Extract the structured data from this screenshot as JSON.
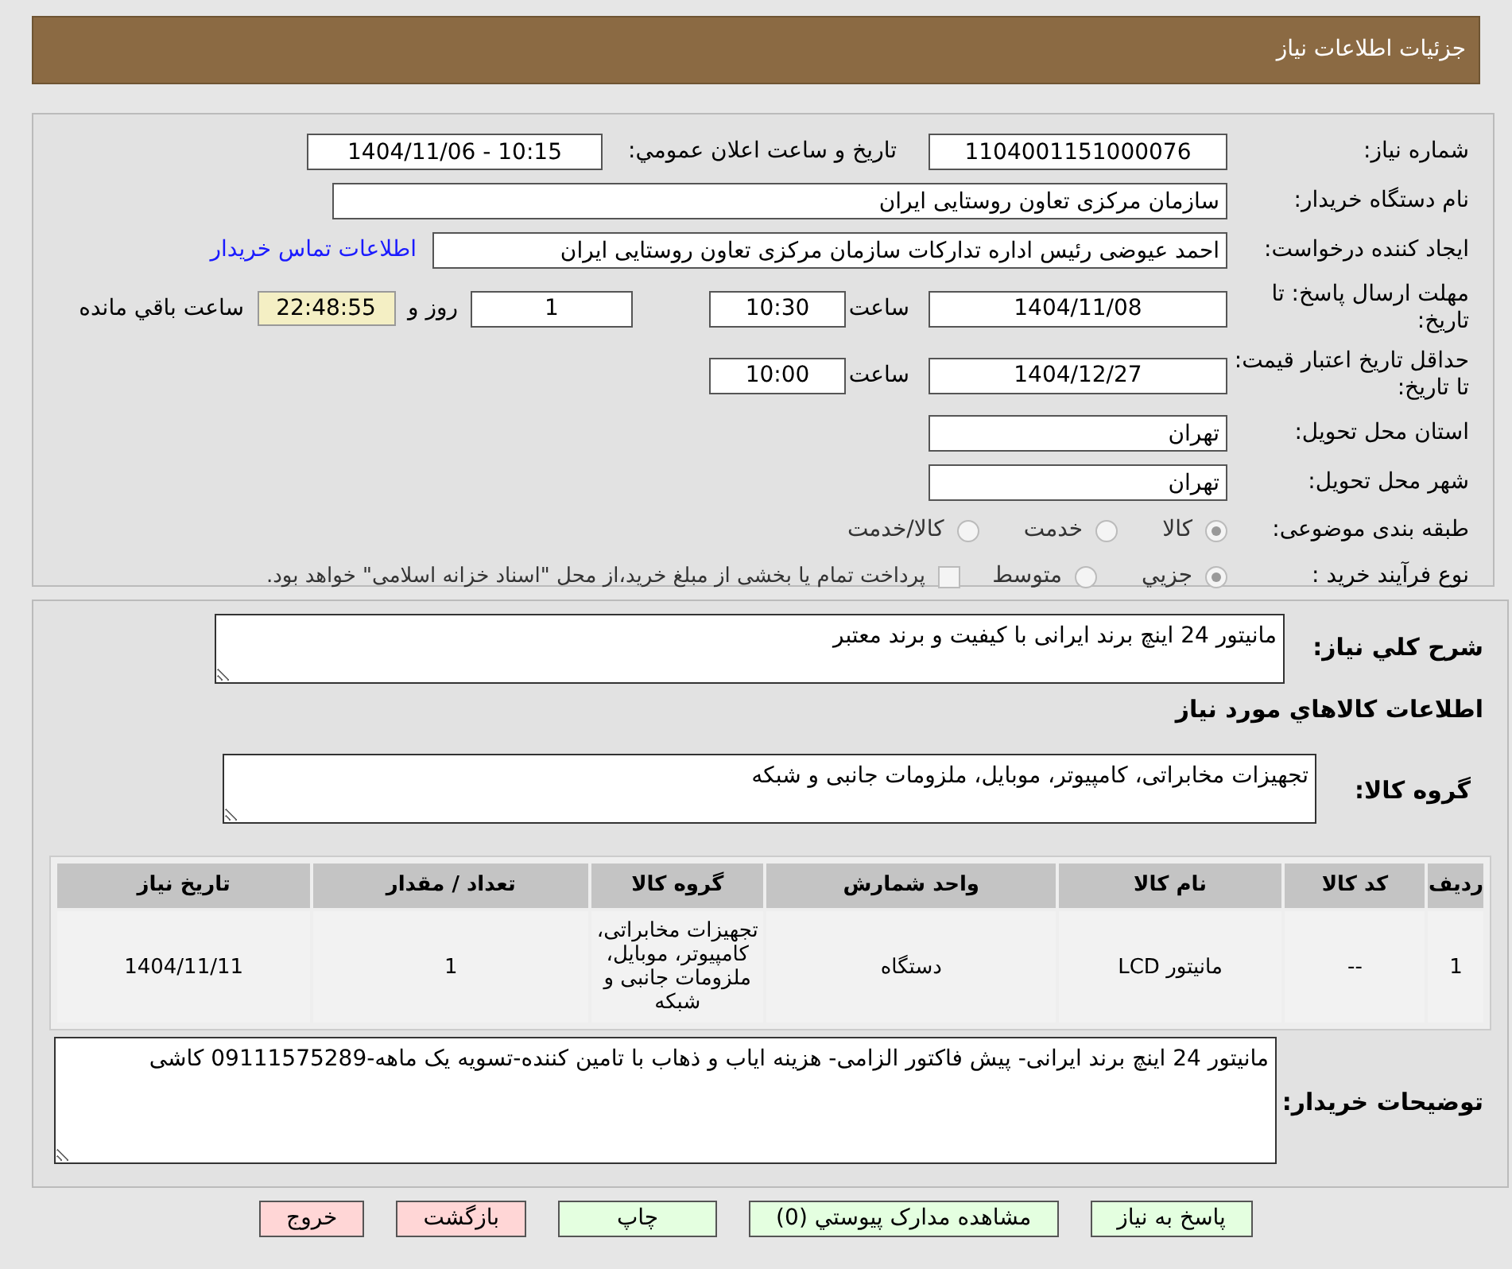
{
  "header": {
    "title": "جزئیات اطلاعات نیاز"
  },
  "need_number": {
    "label": "شماره نیاز:",
    "value": "1104001151000076"
  },
  "announce": {
    "label": "تاريخ و ساعت اعلان عمومي:",
    "value": "1404/11/06 - 10:15"
  },
  "buyer_org": {
    "label": "نام دستگاه خریدار:",
    "value": "سازمان مرکزی تعاون روستایی ایران"
  },
  "requester": {
    "label": "ایجاد کننده درخواست:",
    "value": "احمد عیوضی رئیس اداره تدارکات سازمان مرکزی تعاون روستایی ایران",
    "link": "اطلاعات تماس خریدار"
  },
  "deadline": {
    "label": "مهلت ارسال پاسخ: تا تاریخ:",
    "date": "1404/11/08",
    "time_label": "ساعت",
    "time": "10:30",
    "days": "1",
    "days_suffix": "روز و",
    "remaining": "22:48:55",
    "remaining_suffix": "ساعت باقي مانده"
  },
  "price_validity": {
    "label": "حداقل تاریخ اعتبار قیمت: تا تاریخ:",
    "date": "1404/12/27",
    "time_label": "ساعت",
    "time": "10:00"
  },
  "province": {
    "label": "استان محل تحویل:",
    "value": "تهران"
  },
  "city": {
    "label": "شهر محل تحویل:",
    "value": "تهران"
  },
  "category": {
    "label": "طبقه بندی موضوعی:",
    "options": [
      {
        "label": "کالا",
        "selected": true
      },
      {
        "label": "خدمت",
        "selected": false
      },
      {
        "label": "کالا/خدمت",
        "selected": false
      }
    ]
  },
  "process": {
    "label": "نوع فرآیند خرید :",
    "options": [
      {
        "label": "جزيي",
        "selected": true
      },
      {
        "label": "متوسط",
        "selected": false
      }
    ],
    "payment_note": {
      "checked": false,
      "text": "پرداخت تمام یا بخشی از مبلغ خرید،از محل \"اسناد خزانه اسلامی\" خواهد بود."
    }
  },
  "description": {
    "label": "شرح کلي نياز:",
    "value": "مانیتور 24 اینچ برند ایرانی با کیفیت و برند معتبر"
  },
  "goods_heading": "اطلاعات کالاهاي مورد نياز",
  "goods_group": {
    "label": "گروه کالا:",
    "value": "تجهیزات مخابراتی، کامپیوتر، موبایل، ملزومات جانبی و شبکه"
  },
  "table": {
    "columns": [
      "ردیف",
      "کد کالا",
      "نام کالا",
      "واحد شمارش",
      "گروه کالا",
      "تعداد / مقدار",
      "تاریخ نیاز"
    ],
    "rows": [
      [
        "1",
        "--",
        "مانیتور LCD",
        "دستگاه",
        "تجهیزات مخابراتی، کامپیوتر، موبایل، ملزومات جانبی و شبکه",
        "1",
        "1404/11/11"
      ]
    ]
  },
  "buyer_notes": {
    "label": "توضیحات خریدار:",
    "value": "مانیتور 24 اینچ برند ایرانی- پیش فاکتور الزامی- هزینه ایاب و ذهاب با تامین کننده-تسویه یک ماهه-09111575289 کاشی"
  },
  "buttons": [
    {
      "label": "پاسخ به نیاز",
      "kind": "action"
    },
    {
      "label": "مشاهده مدارک پیوستي (0)",
      "kind": "action"
    },
    {
      "label": "چاپ",
      "kind": "action"
    },
    {
      "label": "بازگشت",
      "kind": "leave"
    },
    {
      "label": "خروج",
      "kind": "leave"
    }
  ]
}
